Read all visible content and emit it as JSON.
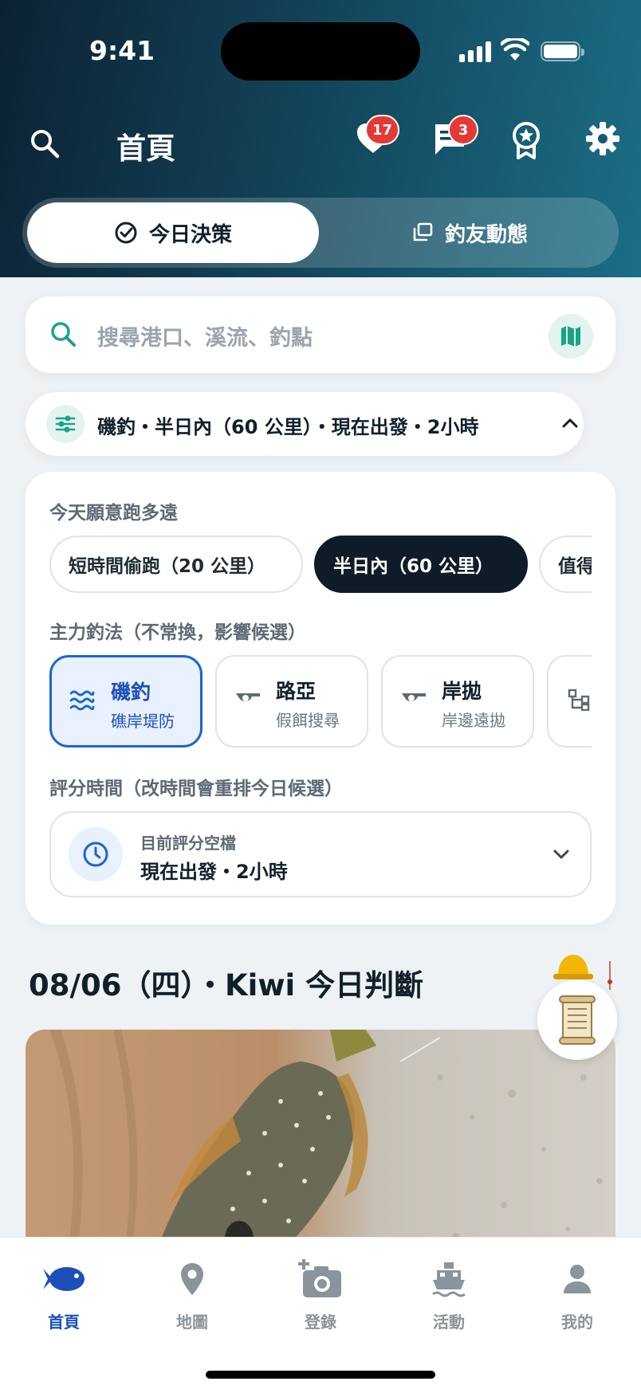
{
  "status_bar": {
    "time": "9:41"
  },
  "header": {
    "title": "首頁",
    "favorites_badge": "17",
    "messages_badge": "3"
  },
  "segment": {
    "active_label": "今日決策",
    "other_label": "釣友動態"
  },
  "search": {
    "placeholder": "搜尋港口、溪流、釣點"
  },
  "filter_summary": "磯釣・半日內（60 公里）・現在出發・2小時",
  "distance": {
    "label": "今天願意跑多遠",
    "options": [
      "短時間偷跑（20 公里）",
      "半日內（60 公里）",
      "值得"
    ],
    "selected_index": 1
  },
  "method": {
    "label": "主力釣法（不常換，影響候選）",
    "options": [
      {
        "title": "磯釣",
        "subtitle": "礁岸堤防",
        "icon": "waves-icon"
      },
      {
        "title": "路亞",
        "subtitle": "假餌搜尋",
        "icon": "lure-icon"
      },
      {
        "title": "岸拋",
        "subtitle": "岸邊遠拋",
        "icon": "lure-icon"
      }
    ],
    "selected_index": 0
  },
  "scoring_time": {
    "label": "評分時間（改時間會重排今日候選）",
    "card_label": "目前評分空檔",
    "card_value": "現在出發・2小時"
  },
  "date_heading": "08/06（四）・Kiwi 今日判斷",
  "bottom_nav": [
    {
      "label": "首頁",
      "icon": "fish-icon",
      "active": true
    },
    {
      "label": "地圖",
      "icon": "map-pin-icon",
      "active": false
    },
    {
      "label": "登錄",
      "icon": "add-photo-icon",
      "active": false
    },
    {
      "label": "活動",
      "icon": "boat-icon",
      "active": false
    },
    {
      "label": "我的",
      "icon": "person-icon",
      "active": false
    }
  ],
  "colors": {
    "accent_blue": "#1c4fb8",
    "teal": "#1aa38a",
    "badge_red": "#e53935",
    "dark": "#0e1c28"
  }
}
